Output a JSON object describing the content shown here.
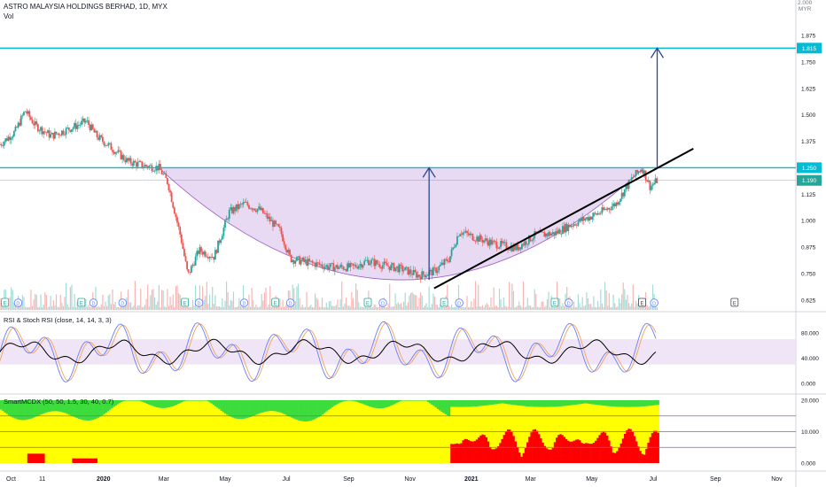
{
  "header": {
    "symbol_title": "ASTRO MALAYSIA HOLDINGS BERHAD, 1D, MYX",
    "volume_label": "Vol",
    "currency_top": "2.000",
    "currency": "MYR"
  },
  "chart_data": [
    {
      "type": "candlestick",
      "panel": "price",
      "title": "ASTRO MALAYSIA HOLDINGS BERHAD, 1D, MYX",
      "ylim": [
        0.6,
        1.85
      ],
      "y_ticks": [
        "1.875",
        "1.750",
        "1.625",
        "1.500",
        "1.375",
        "1.250",
        "1.125",
        "1.000",
        "0.875",
        "0.750",
        "0.625"
      ],
      "x_ticks": [
        "Oct",
        "11",
        "2020",
        "Mar",
        "May",
        "Jul",
        "Sep",
        "Nov",
        "2021",
        "Mar",
        "May",
        "Jul",
        "Sep",
        "Nov"
      ],
      "x_range": [
        "2019-09-20",
        "2021-11-20"
      ],
      "last_price": "1.190",
      "resistance_label": "1.250",
      "target_label": "1.815",
      "cup_low": 0.72,
      "resistance": 1.25,
      "target": 1.815,
      "trendline": {
        "from": [
          "2020-11-25",
          0.68
        ],
        "to": [
          "2021-08-10",
          1.34
        ]
      },
      "arrows": [
        {
          "x": "2020-11-20",
          "from": 0.72,
          "to": 1.25
        },
        {
          "x": "2021-07-05",
          "from": 1.25,
          "to": 1.815
        }
      ],
      "price_path": [
        [
          "2019-09-20",
          1.36
        ],
        [
          "2019-10-05",
          1.42
        ],
        [
          "2019-10-15",
          1.52
        ],
        [
          "2019-10-25",
          1.45
        ],
        [
          "2019-11-10",
          1.4
        ],
        [
          "2019-12-01",
          1.44
        ],
        [
          "2019-12-15",
          1.47
        ],
        [
          "2019-12-25",
          1.4
        ],
        [
          "2020-01-10",
          1.34
        ],
        [
          "2020-01-25",
          1.28
        ],
        [
          "2020-02-10",
          1.26
        ],
        [
          "2020-02-25",
          1.25
        ],
        [
          "2020-03-05",
          1.18
        ],
        [
          "2020-03-18",
          0.92
        ],
        [
          "2020-03-25",
          0.74
        ],
        [
          "2020-04-05",
          0.86
        ],
        [
          "2020-04-20",
          0.83
        ],
        [
          "2020-05-05",
          1.04
        ],
        [
          "2020-05-20",
          1.08
        ],
        [
          "2020-06-05",
          1.05
        ],
        [
          "2020-06-25",
          0.95
        ],
        [
          "2020-07-05",
          0.82
        ],
        [
          "2020-07-25",
          0.8
        ],
        [
          "2020-08-15",
          0.78
        ],
        [
          "2020-09-05",
          0.78
        ],
        [
          "2020-09-20",
          0.81
        ],
        [
          "2020-10-05",
          0.79
        ],
        [
          "2020-10-25",
          0.77
        ],
        [
          "2020-11-10",
          0.74
        ],
        [
          "2020-11-25",
          0.76
        ],
        [
          "2020-12-10",
          0.82
        ],
        [
          "2020-12-20",
          0.95
        ],
        [
          "2021-01-05",
          0.92
        ],
        [
          "2021-01-25",
          0.89
        ],
        [
          "2021-02-15",
          0.87
        ],
        [
          "2021-03-05",
          0.93
        ],
        [
          "2021-03-25",
          0.94
        ],
        [
          "2021-04-10",
          0.98
        ],
        [
          "2021-04-25",
          1.01
        ],
        [
          "2021-05-10",
          1.04
        ],
        [
          "2021-05-25",
          1.08
        ],
        [
          "2021-06-10",
          1.2
        ],
        [
          "2021-06-20",
          1.25
        ],
        [
          "2021-06-28",
          1.16
        ],
        [
          "2021-07-05",
          1.19
        ]
      ]
    },
    {
      "type": "line",
      "panel": "rsi",
      "title": "RSI & Stoch RSI (close, 14, 14, 3, 3)",
      "ylim": [
        0,
        100
      ],
      "y_ticks": [
        "80.000",
        "40.000",
        "0.000"
      ],
      "band": [
        30,
        70
      ]
    },
    {
      "type": "area",
      "panel": "mcdx",
      "title": "SmartMCDX (50, 50, 1.5, 30, 40, 0.7)",
      "ylim": [
        0,
        20
      ],
      "y_ticks": [
        "20.000",
        "10.000",
        "0.000"
      ],
      "reference_lines": [
        15,
        10,
        5
      ],
      "colors": {
        "green": "#3ddc3d",
        "yellow": "#ffff00",
        "red": "#ff0000"
      }
    }
  ],
  "colors": {
    "up": "#26a69a",
    "down": "#ef5350",
    "cup_fill": "#e1cdf0",
    "rsi_band": "#ece1f5",
    "line": "#00bcd4",
    "arrow": "#2a4a8c",
    "badge": "#26a69a"
  }
}
